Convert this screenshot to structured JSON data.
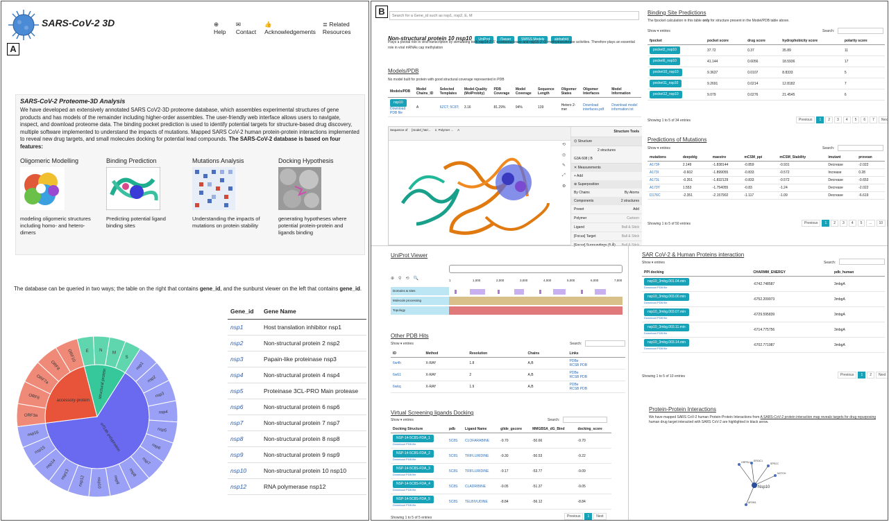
{
  "panelA": {
    "label": "A",
    "logo": "SARS-CoV-2 3D",
    "nav": [
      "Help",
      "Contact",
      "Acknowledgements",
      "Related Resources"
    ],
    "about_title": "SARS-CoV-2 Proteome-3D Analysis",
    "about_text": "We have developed an extensively annotated SARS CoV2-3D proteome database, which assembles experimental structures of gene products and has models of the remainder including higher-order assembles. The user-friendly web interface allows users to navigate, inspect, and download proteome data. The binding pocket prediction is used to identify potential targets for structure-based drug discovery, multiple software implemented to understand the impacts of mutations. Mapped SARS CoV-2 human protein-protein interactions implemented to reveal new drug targets, and small molecules docking for potential lead compounds.",
    "about_bold": "The SARS-CoV-2 database is based on four features:",
    "features": [
      {
        "title": "Oligomeric Modelling",
        "desc": "modeling oligomeric structures including homo- and hetero-dimers"
      },
      {
        "title": "Binding Prediction",
        "desc": "Predicting potential ligand binding sites"
      },
      {
        "title": "Mutations Analysis",
        "desc": "Understanding the impacts of mutations on protein stability"
      },
      {
        "title": "Docking Hypothesis",
        "desc": "generating hypotheses where potential protein-protein and ligands binding"
      }
    ],
    "query_text_1": "The database can be queried in two ways; the table on the right that contains ",
    "query_bold_1": "gene_id",
    "query_text_2": ", and the sunburst viewer on the left that contains ",
    "query_bold_2": "gene_id",
    "query_text_3": ".",
    "sunburst": {
      "center": "orf1ab polyprotein",
      "accessory": "accessory-protein",
      "structural": "structural protein",
      "nsp_labels": [
        "nsp1",
        "nsp2",
        "nsp3",
        "nsp4",
        "nsp5",
        "nsp6",
        "nsp7",
        "nsp8",
        "nsp9",
        "nsp10",
        "nsp12",
        "nsp13",
        "nsp14",
        "nsp15",
        "nsp16"
      ],
      "orf_labels": [
        "ORF3a",
        "ORF6",
        "ORF7a",
        "ORF8",
        "ORF10"
      ],
      "struct_labels": [
        "E",
        "N",
        "M",
        "S"
      ],
      "colors": {
        "center": "#6a6af0",
        "outer": "#9aa0f5",
        "accessory": "#e8543a",
        "accessory_outer": "#f08a78",
        "structural": "#36c79a",
        "structural_outer": "#5fd6ad"
      }
    },
    "gene_table": {
      "headers": [
        "Gene_id",
        "Gene Name"
      ],
      "rows": [
        [
          "nsp1",
          "Host translation inhibitor nsp1"
        ],
        [
          "nsp2",
          "Non-structural protein 2 nsp2"
        ],
        [
          "nsp3",
          "Papain-like proteinase nsp3"
        ],
        [
          "nsp4",
          "Non-structural protein 4 nsp4"
        ],
        [
          "nsp5",
          "Proteinase 3CL-PRO Main protease"
        ],
        [
          "nsp6",
          "Non-structural protein 6 nsp6"
        ],
        [
          "nsp7",
          "Non-structural protein 7 nsp7"
        ],
        [
          "nsp8",
          "Non-structural protein 8 nsp8"
        ],
        [
          "nsp9",
          "Non-structural protein 9 nsp9"
        ],
        [
          "nsp10",
          "Non-structural protein 10 nsp10"
        ],
        [
          "nsp12",
          "RNA polymerase nsp12"
        ]
      ]
    }
  },
  "panelB": {
    "label": "B",
    "search_placeholder": "Search for a Gene_id such as nsp1, nsp2, E, M",
    "protein_title": "Non-structural protein 10 nsp10",
    "protein_buttons": [
      "UniProt",
      "iTasser",
      "SWISS Models",
      "alphafold"
    ],
    "protein_desc": "Plays a pivotal role in viral transcription by stimulating both nsp14 3'-5' exoribonuclease and nsp16 2'-O-methyltransferase activities. Therefore plays an essential role in viral mRNAs cap methylation",
    "models": {
      "title": "Models/PDB",
      "note": "No model built for protein with good structural coverage represented in PDB",
      "headers": [
        "Models/PDB",
        "Model Chains_ID",
        "Selected Templates",
        "Model-Quality (MolProbity)",
        "PDB Coverage",
        "Model Coverage",
        "Sequence Length",
        "Oligomer States",
        "Oligomer Interfaces",
        "Model Information"
      ],
      "row": {
        "model": "nsp10",
        "download": "Download PDB file",
        "chain": "A",
        "templates": "6ZCT; 5C8T;",
        "quality": "3.16",
        "pdb_cov": "81.29%",
        "model_cov": "94%",
        "seq_len": "139",
        "oligo": "Hetero 2-mer",
        "interfaces": "Download interfaces.pdf",
        "info": "Download model information.txt"
      }
    },
    "viewer": {
      "tabs": [
        "Sequence of",
        "[model_hte/...",
        "1: Polymer ...",
        "A"
      ],
      "tools_title": "Structure Tools",
      "structure": "Structure",
      "structures_count": "2 structures",
      "selection": "G3A 608 | B",
      "measurements": "Measurements",
      "add": "Add",
      "superposition": "Superposition",
      "by_chains": "By Chains",
      "by_atoms": "By Atoms",
      "components": "Components",
      "comp_count": "2 structures",
      "preset": "Preset",
      "items": [
        "Polymer",
        "Ligand",
        "[Focus] Target",
        "[Focus] Surroundings (5 Å)"
      ],
      "item_mode": [
        "Cartoon",
        "Ball & Stick",
        "Ball & Stick",
        "Ball & Stick"
      ]
    },
    "binding": {
      "title": "Binding Site Predictions",
      "note_a": "The fpocket calculation in this table ",
      "note_bold": "only",
      "note_b": " for structure present in the Model/PDB table above.",
      "show": "Show",
      "entries": "entries",
      "search": "Search:",
      "headers": [
        "fpocket",
        "pocket score",
        "drug score",
        "hydrophobicity score",
        "polarity score"
      ],
      "rows": [
        [
          "pocket2_nsp10",
          "37.72",
          "0.37",
          "35.89",
          "11"
        ],
        [
          "pocket6_nsp10",
          "41.144",
          "0.6056",
          "18.5936",
          "17"
        ],
        [
          "pocket10_nsp10",
          "9.3637",
          "0.0107",
          "8.8333",
          "5"
        ],
        [
          "pocket11_nsp10",
          "9.2691",
          "0.0214",
          "12.8182",
          "7"
        ],
        [
          "pocket12_nsp10",
          "9.079",
          "0.0276",
          "21.4545",
          "6"
        ]
      ],
      "info": "Showing 1 to 5 of 34 entries",
      "pages": [
        "Previous",
        "1",
        "2",
        "3",
        "4",
        "5",
        "6",
        "7",
        "Next"
      ]
    },
    "mutations": {
      "title": "Predictions of Mutations",
      "show": "Show",
      "entries": "entries",
      "search": "Search:",
      "headers": [
        "mutations",
        "deepddg",
        "maestro",
        "mCSM_ppi",
        "mCSM_Stability",
        "imutant",
        "provean"
      ],
      "rows": [
        [
          "A173F",
          "2.149",
          "-1.838144",
          "-0.859",
          "-0.931",
          "Decrease",
          "-2.022"
        ],
        [
          "A173I",
          "-0.602",
          "-1.899055",
          "-0.833",
          "-0.572",
          "Increase",
          "0.28"
        ],
        [
          "A173L",
          "-0.351",
          "-1.832129",
          "-0.833",
          "-0.572",
          "Decrease",
          "-0.653"
        ],
        [
          "A173Y",
          "1.553",
          "-1.754055",
          "-0.83",
          "-1.24",
          "Decrease",
          "-2.022"
        ],
        [
          "D176C",
          "-2.351",
          "-2.157902",
          "-1.117",
          "-1.09",
          "Decrease",
          "-6.619"
        ]
      ],
      "info": "Showing 1 to 5 of 50 entries",
      "pages": [
        "Previous",
        "1",
        "2",
        "3",
        "4",
        "5",
        "...",
        "10",
        "Next"
      ]
    },
    "uniprot": {
      "title": "UniProt Viewer",
      "ticks": [
        "1",
        "1,000",
        "2,000",
        "3,000",
        "4,000",
        "5,000",
        "6,000",
        "7,000"
      ],
      "tracks": [
        "Domains & sites",
        "Molecule processing",
        "Topology"
      ]
    },
    "pdbhits": {
      "title": "Other PDB Hits",
      "show": "Show",
      "entries": "entries",
      "search": "Search:",
      "headers": [
        "ID",
        "Method",
        "Resolution",
        "Chains",
        "Links"
      ],
      "rows": [
        [
          "6w4h",
          "X-RAY",
          "1.8",
          "A,B",
          "PDBe",
          "RCSB PDB"
        ],
        [
          "6w61",
          "X-RAY",
          "2",
          "A,B",
          "PDBe",
          "RCSB PDB"
        ],
        [
          "6wkq",
          "X-RAY",
          "1.9",
          "A,B",
          "PDBe",
          "RCSB PDB"
        ]
      ]
    },
    "docking": {
      "title": "Virtual Screening ligands Docking",
      "show": "Show",
      "entries": "entries",
      "search": "Search:",
      "headers": [
        "Docking Structure",
        "pdb",
        "Ligand Name",
        "glide_gscore",
        "MMGBSA_dG_Bind",
        "docking_score"
      ],
      "rows": [
        [
          "NSP-14-5C8S-FDA_1",
          "5C8S",
          "CLOFARABINE",
          "-9.70",
          "-50.66",
          "-9.70"
        ],
        [
          "NSP-14-5C8S-FDA_2",
          "5C8S",
          "TRIFLURIDINE",
          "-9.30",
          "-50.53",
          "-9.22"
        ],
        [
          "NSP-14-5C8S-FDA_3",
          "5C8S",
          "TRIFLURIDINE",
          "-9.17",
          "-53.77",
          "-9.09"
        ],
        [
          "NSP-14-5C8S-FDA_4",
          "5C8S",
          "CLADRIBINE",
          "-9.05",
          "-51.37",
          "-9.05"
        ],
        [
          "NSP-14-5C8S-FDA_5",
          "5C8S",
          "TELBIVUDINE",
          "-8.84",
          "-56.12",
          "-8.84"
        ]
      ],
      "download": "Download PDB file",
      "info": "Showing 1 to 5 of 5 entries",
      "pages": [
        "Previous",
        "1",
        "Next"
      ]
    },
    "ppi_dock": {
      "title": "SAR CoV-2 & Human Proteins interaction",
      "show": "Show",
      "entries": "entries",
      "search": "Search:",
      "headers": [
        "PPI docking",
        "CHARMM_ENERGY",
        "pdb_human"
      ],
      "rows": [
        [
          "nsp10_3mbg.001.04.min",
          "-6742.748587",
          "3mbgA"
        ],
        [
          "nsp10_3mbg.003.00.min",
          "-6752.209973",
          "3mbgA"
        ],
        [
          "nsp10_3mbg.003.07.min",
          "-6729.595839",
          "3mbgA"
        ],
        [
          "nsp10_3mbg.003.11.min",
          "-6714.775756",
          "3mbgA"
        ],
        [
          "nsp10_3mbg.003.14.min",
          "-6702.771987",
          "3mbgA"
        ]
      ],
      "download": "Download PDB file",
      "info": "Showing 1 to 5 of 10 entries",
      "pages": [
        "Previous",
        "1",
        "2",
        "Next"
      ]
    },
    "ppi": {
      "title": "Protein-Protein Interactions",
      "text_a": "We have mapped SARS CoV-2 human Protein-Protein Interactions from ",
      "link": "A SARS-CoV-2 protein interaction map reveals targets for drug repurposing",
      "text_b": " human drug target interacted with SARS CoV-2 are highlighted in black arrow.",
      "center": "Nsp10",
      "nodes": [
        "GRPEL1",
        "ERGIC1",
        "SPECC",
        "NOTCH",
        "AP2M1"
      ]
    }
  }
}
